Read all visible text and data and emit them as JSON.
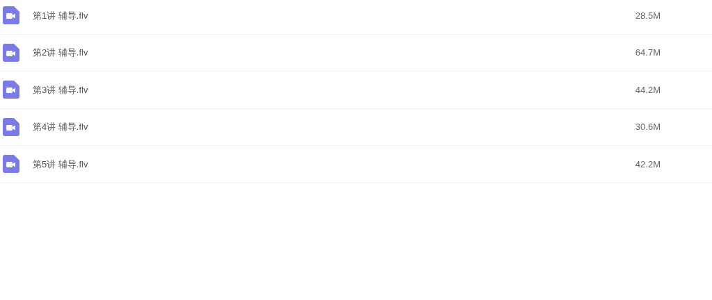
{
  "files": [
    {
      "name": "第1讲 辅导.flv",
      "size": "28.5M"
    },
    {
      "name": "第2讲 辅导.flv",
      "size": "64.7M"
    },
    {
      "name": "第3讲 辅导.flv",
      "size": "44.2M"
    },
    {
      "name": "第4讲 辅导.flv",
      "size": "30.6M"
    },
    {
      "name": "第5讲 辅导.flv",
      "size": "42.2M"
    }
  ]
}
